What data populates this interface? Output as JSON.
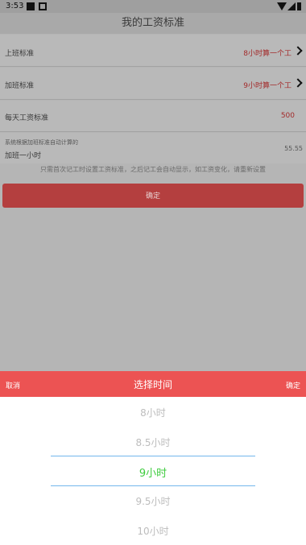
{
  "status_bar": {
    "time": "3:53"
  },
  "title": "我的工资标准",
  "rows": [
    {
      "label": "上班标准",
      "value": "8小时算一个工"
    },
    {
      "label": "加班标准",
      "value": "9小时算一个工"
    },
    {
      "label": "每天工资标准",
      "value": "500"
    }
  ],
  "overtime": {
    "hint": "系统根据加班标准自动计算的",
    "label": "加班一小时",
    "value": "55.55"
  },
  "note": "只需首次记工时设置工资标准，之后记工会自动显示，如工资变化，请重新设置",
  "confirm_label": "确定",
  "picker": {
    "cancel": "取消",
    "title": "选择时间",
    "ok": "确定",
    "items": [
      "8小时",
      "8.5小时",
      "9小时",
      "9.5小时",
      "10小时"
    ],
    "selected": "9小时"
  },
  "colors": {
    "picker_header": "#ec5353",
    "selected": "#3fcc3f",
    "divider": "#73b7ec"
  }
}
